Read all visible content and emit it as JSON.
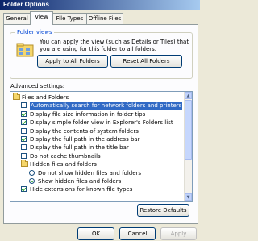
{
  "window": {
    "title": "Folder Options"
  },
  "tabs": [
    {
      "label": "General"
    },
    {
      "label": "View"
    },
    {
      "label": "File Types"
    },
    {
      "label": "Offline Files"
    }
  ],
  "folder_views": {
    "group_label": "Folder views",
    "description": "You can apply the view (such as Details or Tiles) that you are using for this folder to all folders.",
    "apply_all_label": "Apply to All Folders",
    "reset_all_label": "Reset All Folders"
  },
  "advanced": {
    "label": "Advanced settings:",
    "items": [
      {
        "text": "Files and Folders",
        "kind": "folder",
        "level": 0
      },
      {
        "text": "Automatically search for network folders and printers",
        "kind": "checkbox",
        "checked": false,
        "selected": true,
        "level": 1
      },
      {
        "text": "Display file size information in folder tips",
        "kind": "checkbox",
        "checked": true,
        "level": 1
      },
      {
        "text": "Display simple folder view in Explorer's Folders list",
        "kind": "checkbox",
        "checked": true,
        "level": 1
      },
      {
        "text": "Display the contents of system folders",
        "kind": "checkbox",
        "checked": false,
        "level": 1
      },
      {
        "text": "Display the full path in the address bar",
        "kind": "checkbox",
        "checked": true,
        "level": 1
      },
      {
        "text": "Display the full path in the title bar",
        "kind": "checkbox",
        "checked": false,
        "level": 1
      },
      {
        "text": "Do not cache thumbnails",
        "kind": "checkbox",
        "checked": false,
        "level": 1
      },
      {
        "text": "Hidden files and folders",
        "kind": "folder",
        "level": 1
      },
      {
        "text": "Do not show hidden files and folders",
        "kind": "radio",
        "checked": false,
        "level": 2
      },
      {
        "text": "Show hidden files and folders",
        "kind": "radio",
        "checked": true,
        "level": 2
      },
      {
        "text": "Hide extensions for known file types",
        "kind": "checkbox",
        "checked": true,
        "level": 1
      }
    ],
    "restore_defaults_label": "Restore Defaults"
  },
  "buttons": {
    "ok": "OK",
    "cancel": "Cancel",
    "apply": "Apply"
  },
  "colors": {
    "selection": "#316ac5",
    "group_label": "#0046d5",
    "title_bar": "#0a246a"
  }
}
